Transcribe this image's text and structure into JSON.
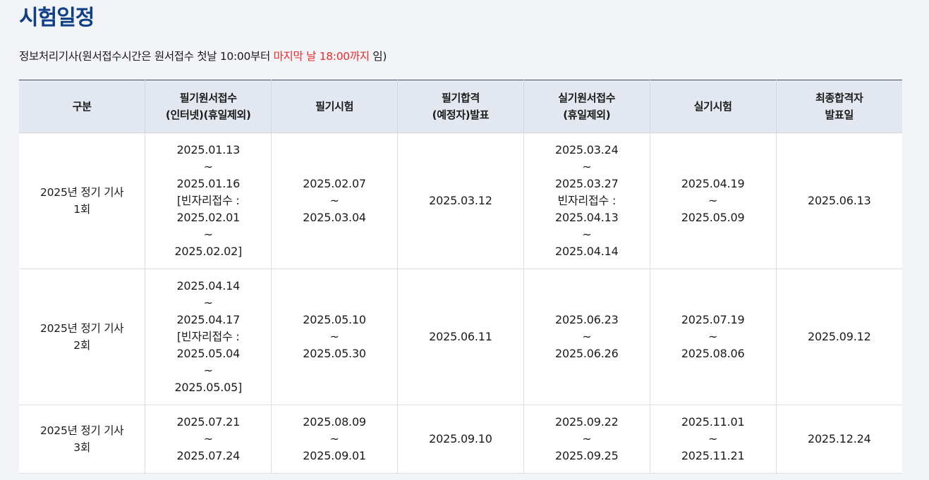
{
  "page": {
    "title": "시험일정",
    "subtitle_prefix": "정보처리기사(원서접수시간은 원서접수 첫날 10:00부터 ",
    "subtitle_highlight": "마지막 날 18:00까지",
    "subtitle_suffix": " 임)",
    "highlight_color": "#ee2b2b",
    "title_color": "#0f3f86"
  },
  "table": {
    "headers": [
      "구분",
      "필기원서접수\n(인터넷)(휴일제외)",
      "필기시험",
      "필기합격\n(예정자)발표",
      "실기원서접수\n(휴일제외)",
      "실기시험",
      "최종합격자\n발표일"
    ],
    "rows": [
      [
        "2025년 정기 기사\n1회",
        "2025.01.13\n~\n2025.01.16\n[빈자리접수 :\n2025.02.01\n~\n2025.02.02]",
        "2025.02.07\n~\n2025.03.04",
        "2025.03.12",
        "2025.03.24\n~\n2025.03.27\n빈자리접수 :\n2025.04.13\n~\n2025.04.14",
        "2025.04.19\n~\n2025.05.09",
        "2025.06.13"
      ],
      [
        "2025년 정기 기사\n2회",
        "2025.04.14\n~\n2025.04.17\n[빈자리접수 :\n2025.05.04\n~\n2025.05.05]",
        "2025.05.10\n~\n2025.05.30",
        "2025.06.11",
        "2025.06.23\n~\n2025.06.26",
        "2025.07.19\n~\n2025.08.06",
        "2025.09.12"
      ],
      [
        "2025년 정기 기사\n3회",
        "2025.07.21\n~\n2025.07.24",
        "2025.08.09\n~\n2025.09.01",
        "2025.09.10",
        "2025.09.22\n~\n2025.09.25",
        "2025.11.01\n~\n2025.11.21",
        "2025.12.24"
      ]
    ]
  }
}
